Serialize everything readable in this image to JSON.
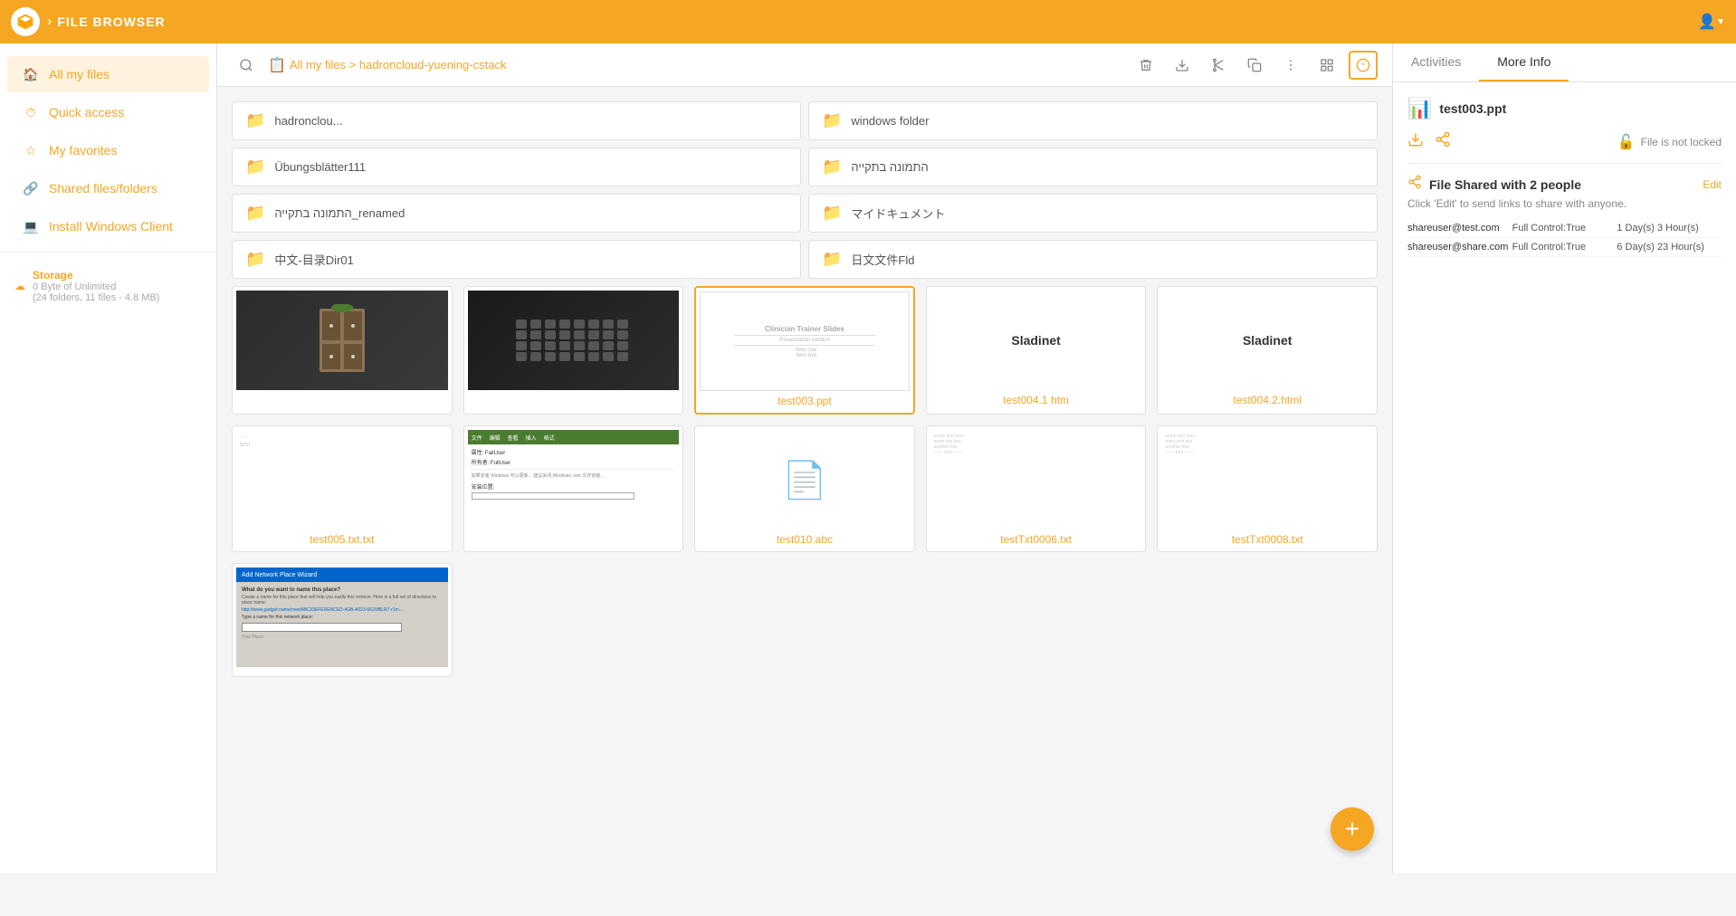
{
  "header": {
    "app_title": "FILE BROWSER",
    "user_icon": "👤",
    "chevron": "▼"
  },
  "breadcrumb": {
    "icon": "📋",
    "path": "All my files > hadroncloud-yuening-cstack"
  },
  "toolbar_actions": {
    "delete": "🗑",
    "download": "⬇",
    "cut": "✂",
    "copy": "⧉",
    "more": "⋮",
    "grid_view": "⊞",
    "info": "ℹ"
  },
  "sidebar": {
    "items": [
      {
        "id": "all-files",
        "label": "All my files",
        "icon": "🏠",
        "active": true
      },
      {
        "id": "quick-access",
        "label": "Quick access",
        "icon": "⏱"
      },
      {
        "id": "favorites",
        "label": "My favorites",
        "icon": "☆"
      },
      {
        "id": "shared",
        "label": "Shared files/folders",
        "icon": "🔗"
      },
      {
        "id": "install",
        "label": "Install Windows Client",
        "icon": "💻"
      }
    ],
    "storage": {
      "label": "Storage",
      "detail1": "0 Byte of Unlimited",
      "detail2": "(24 folders, 11 files - 4.8 MB)"
    }
  },
  "folders": [
    {
      "name": "hadronclou..."
    },
    {
      "name": "windows folder"
    },
    {
      "name": "Übungsblätter111"
    },
    {
      "name": "התמונה בתקייה"
    },
    {
      "name": "התמונה בתקייה_renamed"
    },
    {
      "name": "マイドキュメント"
    },
    {
      "name": "中文-目录Dir01"
    },
    {
      "name": "日文文件Fld"
    }
  ],
  "files": [
    {
      "id": "photo1",
      "name": "",
      "type": "photo_cabinet",
      "selected": false
    },
    {
      "id": "photo2",
      "name": "",
      "type": "photo_keyboard",
      "selected": false
    },
    {
      "id": "test003",
      "name": "test003.ppt",
      "type": "ppt",
      "selected": true
    },
    {
      "id": "test004_1",
      "name": "test004.1 htm",
      "type": "sladinet",
      "selected": false
    },
    {
      "id": "test004_2",
      "name": "test004.2.html",
      "type": "sladinet",
      "selected": false
    },
    {
      "id": "test005",
      "name": "test005.txt.txt",
      "type": "txt_blank",
      "selected": false
    },
    {
      "id": "test006_screenshot",
      "name": "",
      "type": "chinese_window",
      "selected": false
    },
    {
      "id": "test010",
      "name": "test010.abc",
      "type": "abc",
      "selected": false
    },
    {
      "id": "testTxt0006",
      "name": "testTxt0006.txt",
      "type": "txt_lines",
      "selected": false
    },
    {
      "id": "testTxt0008",
      "name": "testTxt0008.txt",
      "type": "txt_lines2",
      "selected": false
    },
    {
      "id": "dialog_screenshot",
      "name": "",
      "type": "dialog_window",
      "selected": false
    }
  ],
  "right_panel": {
    "tabs": [
      "Activities",
      "More Info"
    ],
    "active_tab": "More Info",
    "file_name": "test003.ppt",
    "lock_status": "File is not locked",
    "share": {
      "title": "File Shared with 2 people",
      "edit_label": "Edit",
      "subtitle": "Click 'Edit' to send links to share with anyone.",
      "people": [
        {
          "email": "shareuser@test.com",
          "permission": "Full Control:True",
          "expiry": "1 Day(s) 3 Hour(s)"
        },
        {
          "email": "shareuser@share.com",
          "permission": "Full Control:True",
          "expiry": "6 Day(s) 23 Hour(s)"
        }
      ]
    }
  },
  "fab": "+"
}
